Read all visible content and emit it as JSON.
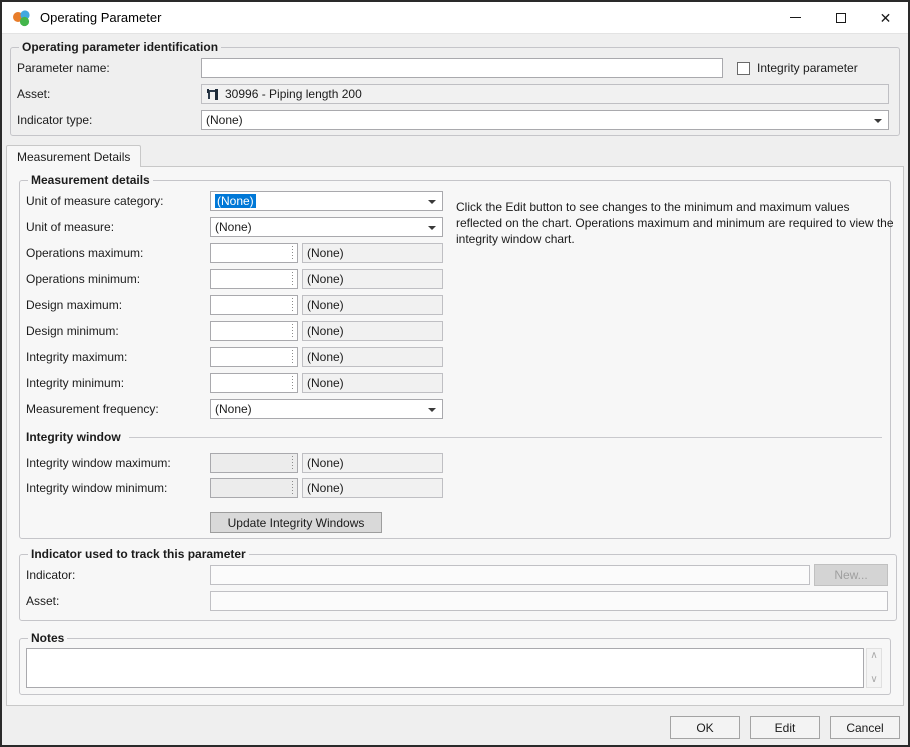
{
  "colors": {
    "selection": "#0078d7",
    "app_icon": [
      "#e87d2a",
      "#41a8e0",
      "#43b54b"
    ]
  },
  "icons": {
    "app_icon": "three-spheres",
    "asset_icon": "pipe-elbow",
    "minimize_icon": "minimize-dash",
    "maximize_icon": "maximize-square",
    "close_icon": "✕",
    "dropdown_arrow_icon": "▾",
    "spinner_icon": "dotted-spin-strip",
    "scroll_up": "∧",
    "scroll_down": "∨"
  },
  "window": {
    "title": "Operating Parameter"
  },
  "identification": {
    "legend": "Operating parameter identification",
    "parameter_name": {
      "label": "Parameter name:",
      "value": ""
    },
    "integrity_parameter": {
      "label": "Integrity parameter",
      "checked": false
    },
    "asset": {
      "label": "Asset:",
      "value": "30996 - Piping length 200"
    },
    "indicator_type": {
      "label": "Indicator type:",
      "value": "(None)"
    }
  },
  "tabs": [
    {
      "label": "Measurement Details",
      "active": true
    }
  ],
  "measurement": {
    "legend": "Measurement details",
    "help_text": "Click the Edit button to see changes to the minimum and maximum values reflected on the chart.  Operations maximum and minimum are required to view the integrity window chart.",
    "unit_category": {
      "label": "Unit of measure category:",
      "value": "(None)",
      "selected": true
    },
    "unit": {
      "label": "Unit of measure:",
      "value": "(None)"
    },
    "spin_rows": [
      {
        "label": "Operations maximum:",
        "value": "",
        "unit": "(None)"
      },
      {
        "label": "Operations minimum:",
        "value": "",
        "unit": "(None)"
      },
      {
        "label": "Design maximum:",
        "value": "",
        "unit": "(None)"
      },
      {
        "label": "Design minimum:",
        "value": "",
        "unit": "(None)"
      },
      {
        "label": "Integrity maximum:",
        "value": "",
        "unit": "(None)"
      },
      {
        "label": "Integrity minimum:",
        "value": "",
        "unit": "(None)"
      }
    ],
    "frequency": {
      "label": "Measurement frequency:",
      "value": "(None)"
    },
    "integrity_window": {
      "legend": "Integrity window",
      "rows": [
        {
          "label": "Integrity window maximum:",
          "value": "",
          "unit": "(None)"
        },
        {
          "label": "Integrity window minimum:",
          "value": "",
          "unit": "(None)"
        }
      ],
      "update_button": "Update Integrity Windows"
    }
  },
  "indicator_section": {
    "legend": "Indicator used to track this parameter",
    "indicator": {
      "label": "Indicator:",
      "value": ""
    },
    "new_button": "New...",
    "asset": {
      "label": "Asset:",
      "value": ""
    }
  },
  "notes": {
    "legend": "Notes",
    "value": ""
  },
  "footer": {
    "ok": "OK",
    "edit": "Edit",
    "cancel": "Cancel"
  }
}
